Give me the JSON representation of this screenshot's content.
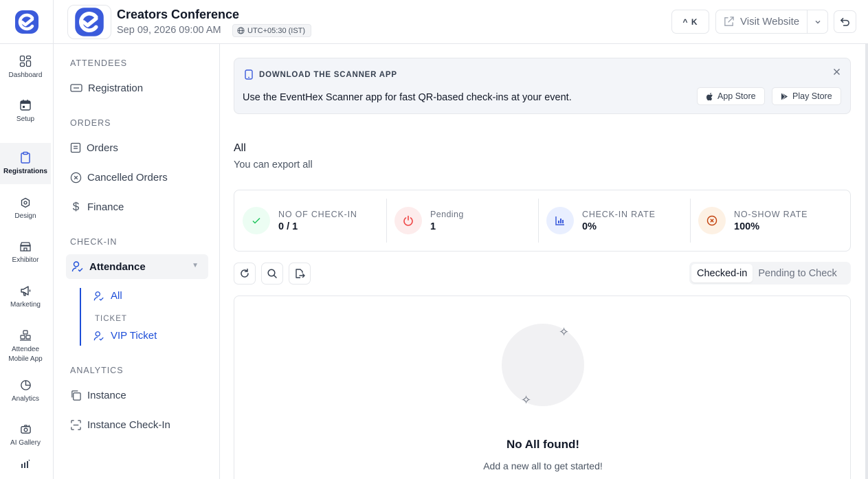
{
  "header": {
    "event_title": "Creators Conference",
    "event_date": "Sep 09, 2026 09:00 AM",
    "timezone": "UTC+05:30 (IST)",
    "shortcut_label": "^ K",
    "visit_label": "Visit Website"
  },
  "rail": {
    "items": [
      {
        "label": "Dashboard",
        "icon": "grid-icon"
      },
      {
        "label": "Setup",
        "icon": "calendar-icon"
      },
      {
        "label": "Registrations",
        "icon": "clipboard-icon",
        "active": true
      },
      {
        "label": "Design",
        "icon": "palette-icon"
      },
      {
        "label": "Exhibitor",
        "icon": "store-icon"
      },
      {
        "label": "Marketing",
        "icon": "megaphone-icon"
      },
      {
        "label": "Attendee",
        "label2": "Mobile App",
        "icon": "boxes-icon"
      },
      {
        "label": "Analytics",
        "icon": "pie-chart-icon"
      },
      {
        "label": "AI Gallery",
        "icon": "camera-icon"
      }
    ]
  },
  "subnav": {
    "attendees_head": "ATTENDEES",
    "registration": "Registration",
    "orders_head": "ORDERS",
    "orders": "Orders",
    "cancelled_orders": "Cancelled Orders",
    "finance": "Finance",
    "checkin_head": "CHECK-IN",
    "attendance": "Attendance",
    "all": "All",
    "ticket_head": "TICKET",
    "vip_ticket": "VIP Ticket",
    "analytics_head": "ANALYTICS",
    "instance": "Instance",
    "instance_checkin": "Instance Check-In"
  },
  "banner": {
    "title": "DOWNLOAD THE SCANNER APP",
    "text": "Use the EventHex Scanner app for fast QR-based check-ins at your event.",
    "app_store": "App Store",
    "play_store": "Play Store"
  },
  "section": {
    "title": "All",
    "subtitle": "You can export all"
  },
  "stats": [
    {
      "label": "NO OF CHECK-IN",
      "value": "0 / 1",
      "color": "#22c55e"
    },
    {
      "label": "Pending",
      "value": "1",
      "color": "#ef4444"
    },
    {
      "label": "CHECK-IN RATE",
      "value": "0%",
      "color": "#3b5bdb"
    },
    {
      "label": "NO-SHOW RATE",
      "value": "100%",
      "color": "#c2410c"
    }
  ],
  "filters": {
    "checked_in": "Checked-in",
    "pending": "Pending to Check"
  },
  "empty": {
    "title": "No All found!",
    "subtitle": "Add a new all to get started!"
  },
  "colors": {
    "brand": "#3b5bdb",
    "active_link": "#1d4ed8"
  }
}
